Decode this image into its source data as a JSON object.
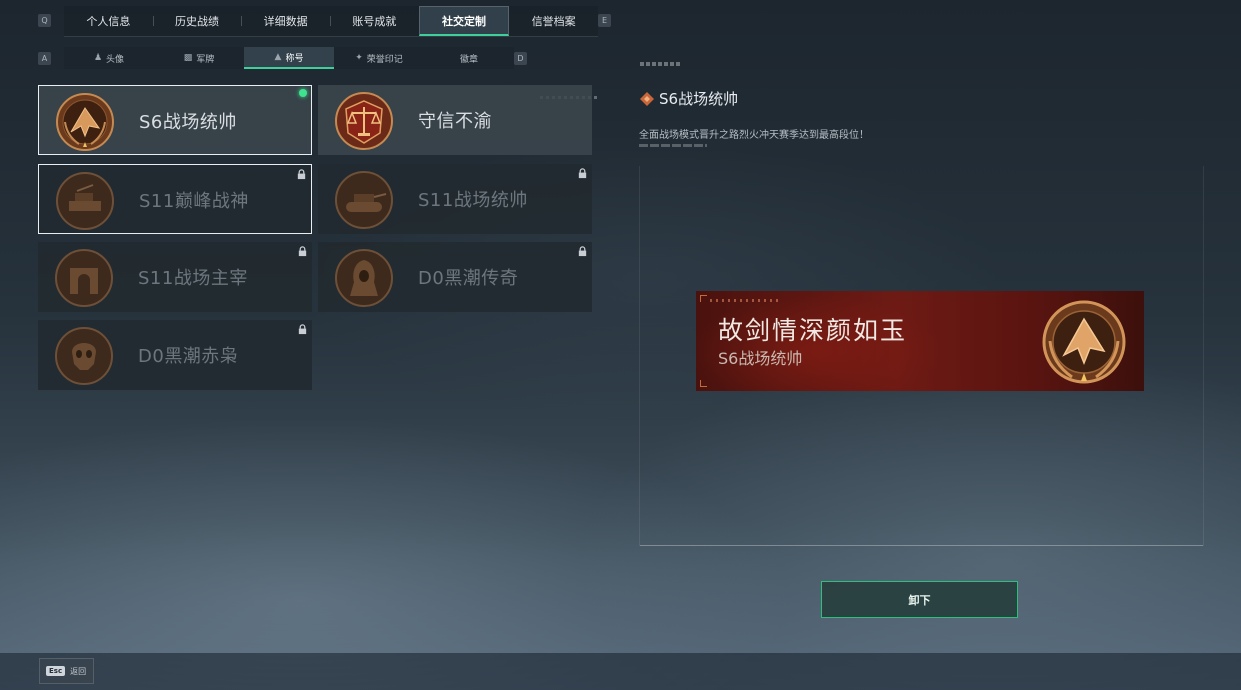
{
  "top_tabs": {
    "left_key": "Q",
    "right_key": "E",
    "items": [
      {
        "label": "个人信息",
        "active": false
      },
      {
        "label": "历史战绩",
        "active": false
      },
      {
        "label": "详细数据",
        "active": false
      },
      {
        "label": "账号成就",
        "active": false
      },
      {
        "label": "社交定制",
        "active": true
      },
      {
        "label": "信誉档案",
        "active": false
      }
    ]
  },
  "sub_tabs": {
    "left_key": "A",
    "right_key": "D",
    "items": [
      {
        "label": "头像",
        "icon": "person-icon",
        "active": false
      },
      {
        "label": "军牌",
        "icon": "dogtag-icon",
        "active": false
      },
      {
        "label": "称号",
        "icon": "title-icon",
        "active": true
      },
      {
        "label": "荣誉印记",
        "icon": "honor-mark-icon",
        "active": false
      },
      {
        "label": "徽章",
        "icon": "",
        "active": false
      }
    ]
  },
  "titles": [
    {
      "name": "S6战场统帅",
      "emblem": "jet-emblem",
      "locked": false,
      "selected": true,
      "equipped": true
    },
    {
      "name": "守信不渝",
      "emblem": "scales-emblem",
      "locked": false,
      "selected": false,
      "equipped": false
    },
    {
      "name": "S11巅峰战神",
      "emblem": "radar-vehicle-emblem",
      "locked": true,
      "selected": true,
      "equipped": false
    },
    {
      "name": "S11战场统帅",
      "emblem": "tank-emblem",
      "locked": true,
      "selected": false,
      "equipped": false
    },
    {
      "name": "S11战场主宰",
      "emblem": "arch-emblem",
      "locked": true,
      "selected": false,
      "equipped": false
    },
    {
      "name": "D0黑潮传奇",
      "emblem": "hooded-figure-emblem",
      "locked": true,
      "selected": false,
      "equipped": false
    },
    {
      "name": "D0黑潮赤枭",
      "emblem": "skull-emblem",
      "locked": true,
      "selected": false,
      "equipped": false
    }
  ],
  "detail": {
    "title": "S6战场统帅",
    "description": "全面战场模式晋升之路烈火冲天赛季达到最高段位！",
    "banner_title": "故剑情深颜如玉",
    "banner_subtitle": "S6战场统帅"
  },
  "unequip_label": "卸下",
  "footer": {
    "key": "Esc",
    "label": "返回"
  },
  "colors": {
    "accent": "#3ecf9a",
    "equipped_dot": "#3ee28f",
    "bronze": "#b87a45",
    "banner_red": "#6e1a14"
  }
}
